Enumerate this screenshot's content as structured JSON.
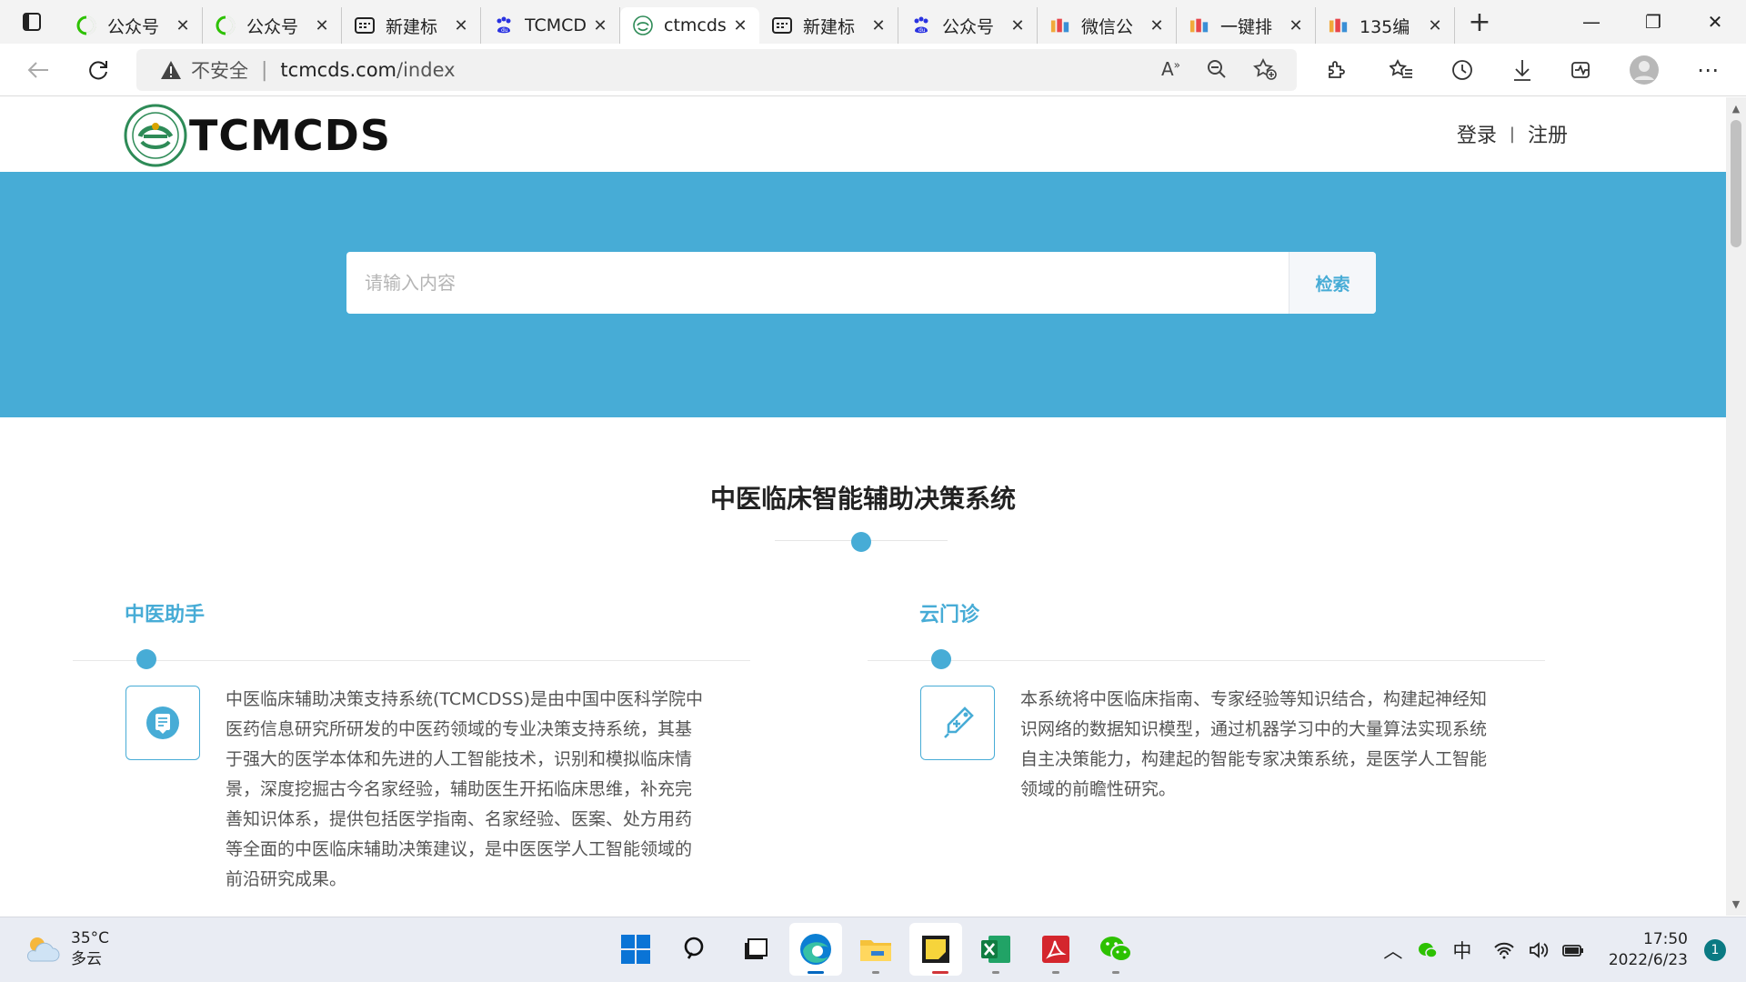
{
  "browser": {
    "tabs": [
      {
        "title": "公众号",
        "icon": "wechat-mp-favicon"
      },
      {
        "title": "公众号",
        "icon": "wechat-mp-favicon"
      },
      {
        "title": "新建标",
        "icon": "newtab-favicon"
      },
      {
        "title": "TCMCD",
        "icon": "baidu-favicon"
      },
      {
        "title": "ctmcds",
        "icon": "tcmcds-favicon"
      },
      {
        "title": "新建标",
        "icon": "newtab-favicon"
      },
      {
        "title": "公众号",
        "icon": "baidu-favicon"
      },
      {
        "title": "微信公",
        "icon": "editor-135-favicon"
      },
      {
        "title": "一键排",
        "icon": "editor-135-favicon"
      },
      {
        "title": "135编",
        "icon": "editor-135-favicon"
      }
    ],
    "active_tab_index": 4,
    "close_glyph": "✕",
    "newtab_glyph": "+",
    "address": {
      "security_label": "不安全",
      "separator": "|",
      "host": "tcmcds.com",
      "path": "/index"
    },
    "window_controls": {
      "minimize": "—",
      "restore": "❐",
      "close": "✕"
    }
  },
  "site": {
    "logo_text": "TCMCDS",
    "auth": {
      "login": "登录",
      "separator": "|",
      "register": "注册"
    },
    "search": {
      "placeholder": "请输入内容",
      "button": "检索"
    },
    "section_title": "中医临床智能辅助决策系统",
    "columns": [
      {
        "title": "中医助手",
        "icon": "book-bookmark-icon",
        "text": "中医临床辅助决策支持系统(TCMCDSS)是由中国中医科学院中医药信息研究所研发的中医药领域的专业决策支持系统，其基于强大的医学本体和先进的人工智能技术，识别和模拟临床情景，深度挖掘古今名家经验，辅助医生开拓临床思维，补充完善知识体系，提供包括医学指南、名家经验、医案、处方用药等全面的中医临床辅助决策建议，是中医医学人工智能领域的前沿研究成果。"
      },
      {
        "title": "云门诊",
        "icon": "medicine-tag-icon",
        "text": "本系统将中医临床指南、专家经验等知识结合，构建起神经知识网络的数据知识模型，通过机器学习中的大量算法实现系统自主决策能力，构建起的智能专家决策系统，是医学人工智能领域的前瞻性研究。"
      }
    ],
    "accent_color": "#47acd6"
  },
  "taskbar": {
    "weather": {
      "temp": "35°C",
      "desc": "多云"
    },
    "ime": "中",
    "time": "17:50",
    "date": "2022/6/23",
    "notifications": "1"
  }
}
